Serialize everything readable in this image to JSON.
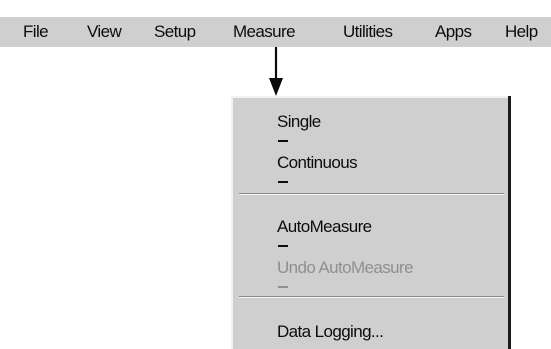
{
  "menubar": {
    "items": [
      {
        "label": "File"
      },
      {
        "label": "View"
      },
      {
        "label": "Setup"
      },
      {
        "label": "Measure"
      },
      {
        "label": "Utilities"
      },
      {
        "label": "Apps"
      },
      {
        "label": "Help"
      }
    ]
  },
  "measure_menu": {
    "items": [
      {
        "label": "Single",
        "enabled": true
      },
      {
        "label": "Continuous",
        "enabled": true
      },
      {
        "label": "AutoMeasure",
        "enabled": true
      },
      {
        "label": "Undo AutoMeasure",
        "enabled": false
      },
      {
        "label": "Data Logging...",
        "enabled": true
      }
    ]
  },
  "icons": {
    "pointer": "down-arrow-icon"
  },
  "colors": {
    "menu_background": "#cfcfcf",
    "text": "#0c0c0c",
    "disabled_text": "#8f8f8f"
  }
}
